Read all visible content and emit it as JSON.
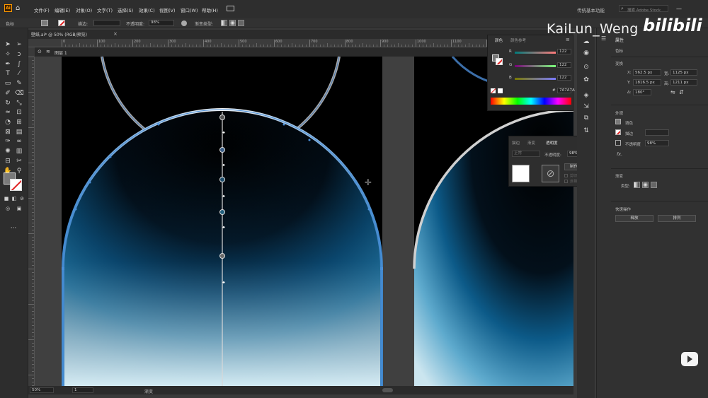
{
  "app": {
    "logo": "Ai"
  },
  "menu": [
    "文件(F)",
    "编辑(E)",
    "对象(O)",
    "文字(T)",
    "选择(S)",
    "效果(C)",
    "视图(V)",
    "窗口(W)",
    "帮助(H)"
  ],
  "workspace": "传统基本功能",
  "search": {
    "placeholder": "搜索 Adobe Stock"
  },
  "control_bar": {
    "label": "色标",
    "stroke_label": "描边:",
    "opacity_label": "不透明度:",
    "opacity_value": "98%",
    "gradient_type_label": "渐变类型:"
  },
  "document": {
    "tab": "壁纸.ai* @ 50% (RGB/预览)"
  },
  "layer": {
    "name": "图层 1"
  },
  "ruler": {
    "h_ticks": [
      "0",
      "100",
      "200",
      "300",
      "400",
      "500",
      "600",
      "700",
      "800",
      "900",
      "1000",
      "1100",
      "1200",
      "1300",
      "1400"
    ]
  },
  "status": {
    "zoom": "50%",
    "artboard": "1",
    "tool": "渐变"
  },
  "color_panel": {
    "tabs": [
      "颜色",
      "颜色参考"
    ],
    "channels": [
      {
        "name": "R",
        "value": "122"
      },
      {
        "name": "G",
        "value": "122"
      },
      {
        "name": "B",
        "value": "122"
      }
    ],
    "hex": "7A7A7A"
  },
  "transparency_panel": {
    "tabs": [
      "描边",
      "渐变",
      "透明度"
    ],
    "blend_mode": "正常",
    "opacity_label": "不透明度:",
    "opacity_value": "98%",
    "make_mask": "制作蒙版",
    "clip": "剪切",
    "invert": "反相蒙版"
  },
  "properties": {
    "title": "属性",
    "section_label": "色标",
    "transform_title": "变换",
    "x_label": "X:",
    "x": "562.5 px",
    "w_label": "宽:",
    "w": "1125 px",
    "y_label": "Y:",
    "y": "1816.5 px",
    "h_label": "高:",
    "h": "1211 px",
    "angle_label": "∆:",
    "angle": "180°",
    "appearance_title": "外观",
    "fill_label": "填色",
    "stroke_label": "描边",
    "opacity_label": "不透明度",
    "opacity": "98%",
    "fx_label": "fx.",
    "gradient_title": "渐变",
    "gradient_type_label": "类型:",
    "quick_actions_title": "快速操作",
    "release_button": "释放",
    "arrange_button": "排列"
  },
  "watermark": {
    "name": "KaiLun_Weng",
    "logo": "bilibili"
  },
  "colors": {
    "accent": "#4a8fd9",
    "canvas_bg": "#000000",
    "panel": "#313131"
  }
}
